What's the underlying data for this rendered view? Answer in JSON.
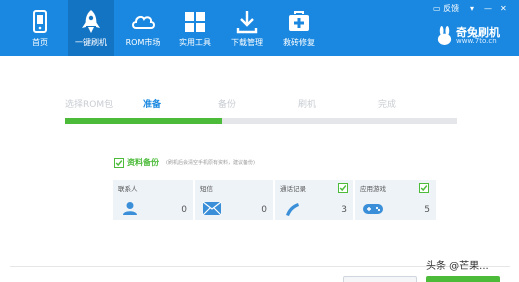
{
  "nav": {
    "items": [
      {
        "label": "首页",
        "icon": "phone-icon"
      },
      {
        "label": "一键刷机",
        "icon": "rocket-icon"
      },
      {
        "label": "ROM市场",
        "icon": "cloud-icon"
      },
      {
        "label": "实用工具",
        "icon": "grid-icon"
      },
      {
        "label": "下载管理",
        "icon": "download-icon"
      },
      {
        "label": "救砖修复",
        "icon": "medkit-icon"
      }
    ],
    "active_index": 1
  },
  "window": {
    "feedback_label": "反馈",
    "menu_glyph": "▾",
    "minimize_glyph": "—",
    "close_glyph": "✕"
  },
  "brand": {
    "name": "奇兔刷机",
    "url": "www.7to.cn"
  },
  "steps": {
    "items": [
      "选择ROM包",
      "准备",
      "备份",
      "刷机",
      "完成"
    ],
    "current_index": 1,
    "progress_fraction": 0.4
  },
  "backup": {
    "label": "资料备份",
    "hint": "(刷机后会清空手机原有资料，建议备份)",
    "checked": true,
    "cards": [
      {
        "title": "联系人",
        "count": "0",
        "icon": "contact-icon",
        "checked": false
      },
      {
        "title": "短信",
        "count": "0",
        "icon": "sms-icon",
        "checked": false
      },
      {
        "title": "通话记录",
        "count": "3",
        "icon": "phone-call-icon",
        "checked": true
      },
      {
        "title": "应用游戏",
        "count": "5",
        "icon": "gamepad-icon",
        "checked": true
      }
    ]
  },
  "watermark": "头条 @芒果...",
  "colors": {
    "toolbar": "#1a88e0",
    "toolbar_active": "#1474c4",
    "accent_green": "#4cbb3a",
    "step_active": "#1a88e0",
    "step_inactive": "#c8ccd2",
    "card_bg": "#eef3f8",
    "icon_blue": "#3a8fd8"
  }
}
